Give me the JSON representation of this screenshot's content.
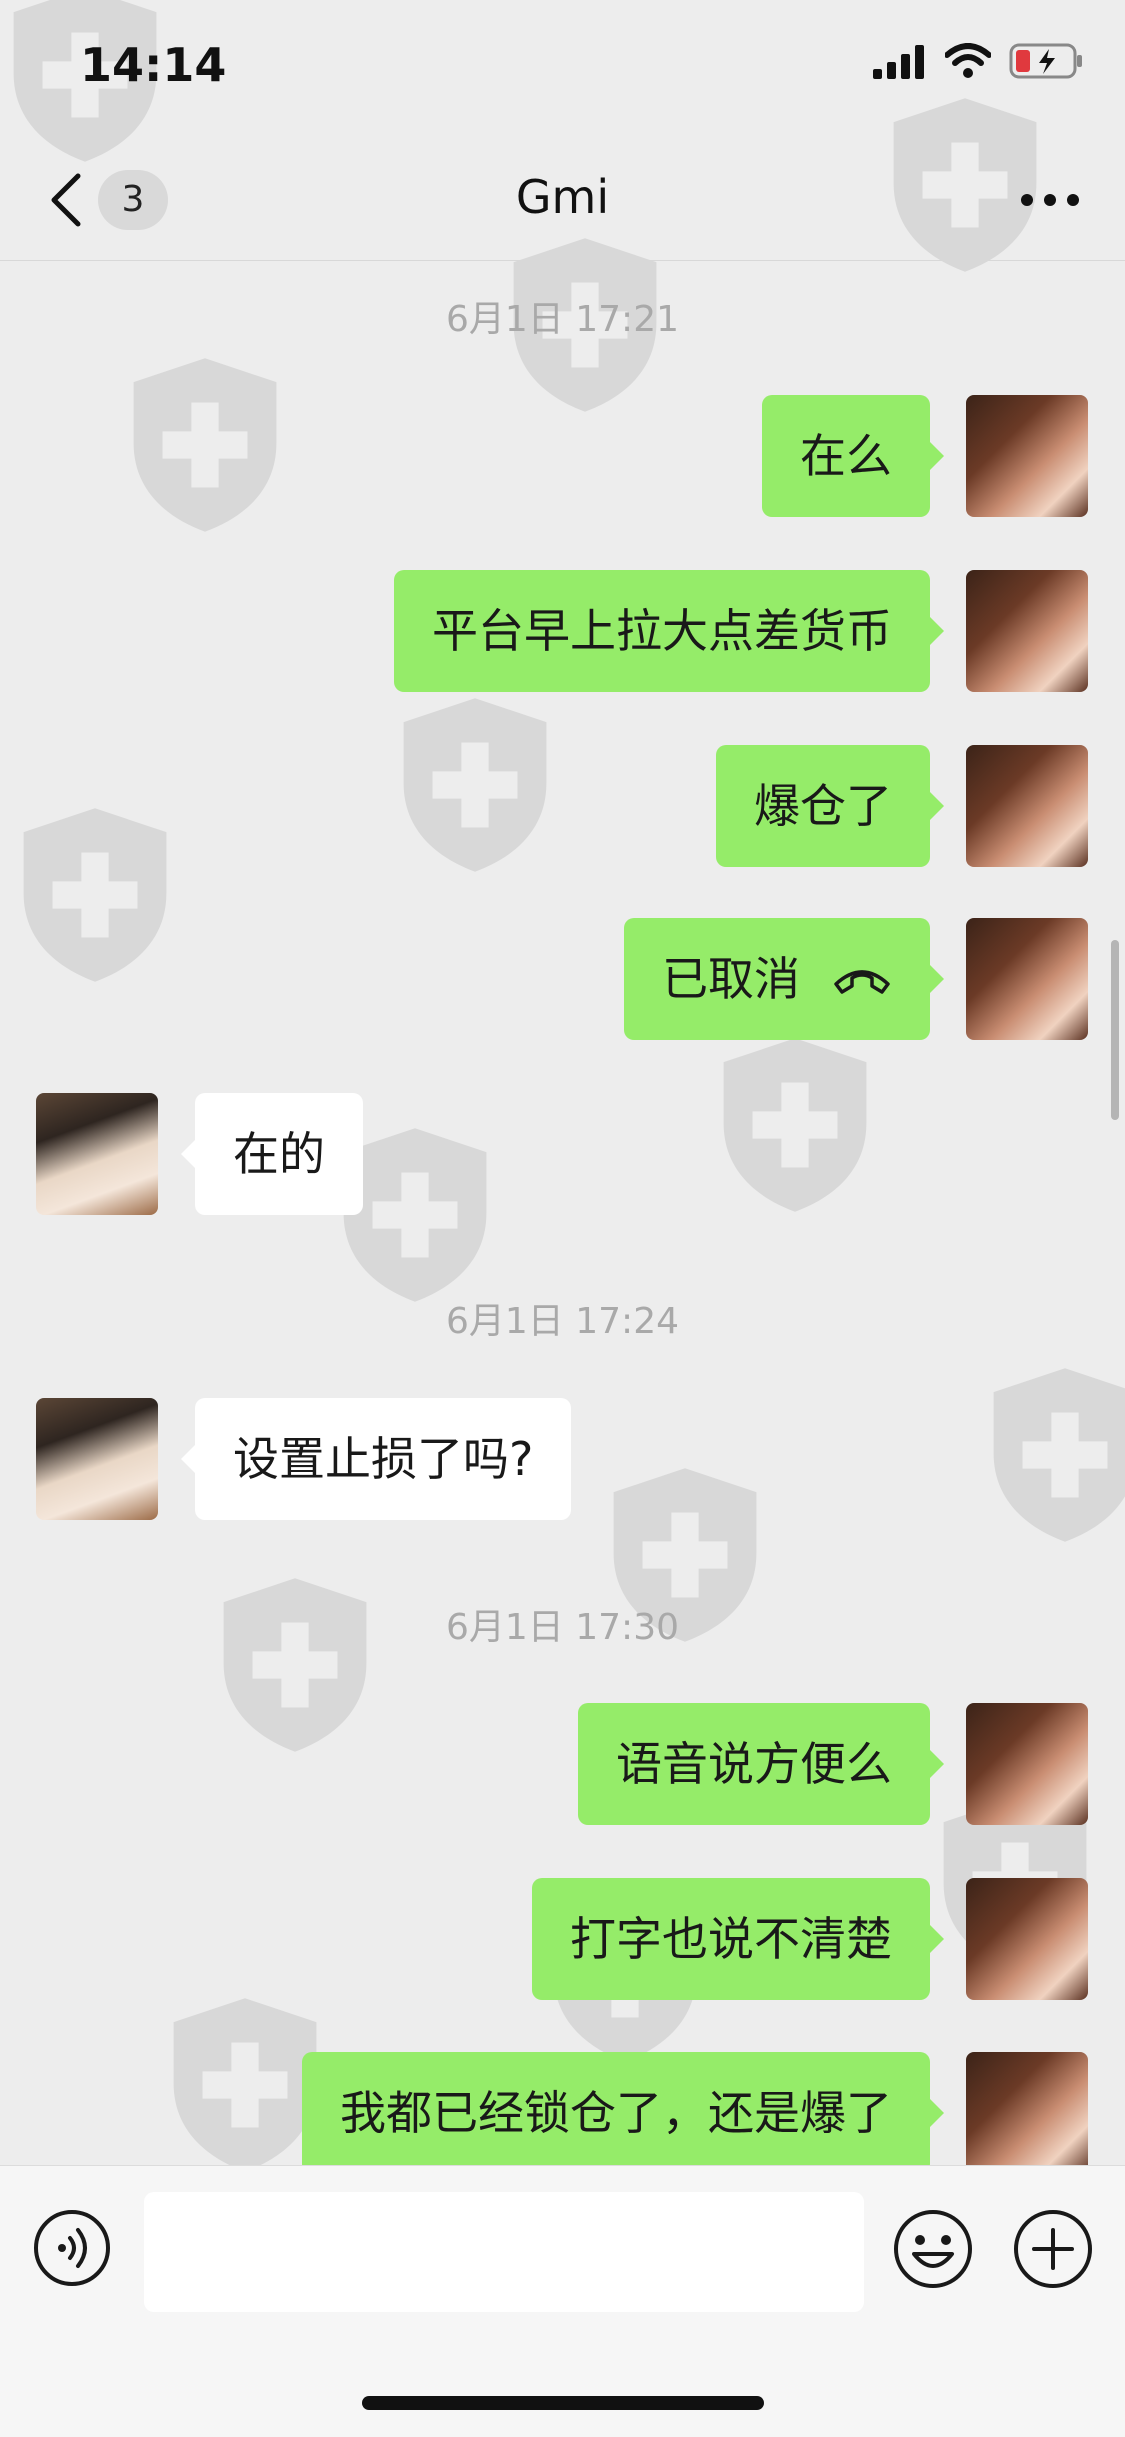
{
  "status_bar": {
    "time": "14:14"
  },
  "nav": {
    "unread_count": "3",
    "title": "Gmi"
  },
  "timestamps": [
    "6月1日 17:21",
    "6月1日 17:24",
    "6月1日 17:30"
  ],
  "messages": [
    {
      "text": "在么"
    },
    {
      "text": "平台早上拉大点差货币"
    },
    {
      "text": "爆仓了"
    },
    {
      "text": "已取消"
    },
    {
      "text": "在的"
    },
    {
      "text": "设置止损了吗?"
    },
    {
      "text": "语音说方便么"
    },
    {
      "text": "打字也说不清楚"
    },
    {
      "text": "我都已经锁仓了，还是爆了"
    }
  ],
  "icons": {
    "back": "chevron-left-icon",
    "more": "more-dots-icon",
    "call": "phone-hangup-icon",
    "voice": "voice-icon",
    "emoji": "emoji-icon",
    "plus": "plus-icon"
  },
  "colors": {
    "background": "#ededed",
    "my_bubble": "#95ec69",
    "their_bubble": "#ffffff",
    "timestamp": "#a9a9a9",
    "battery_low": "#e0393e"
  }
}
